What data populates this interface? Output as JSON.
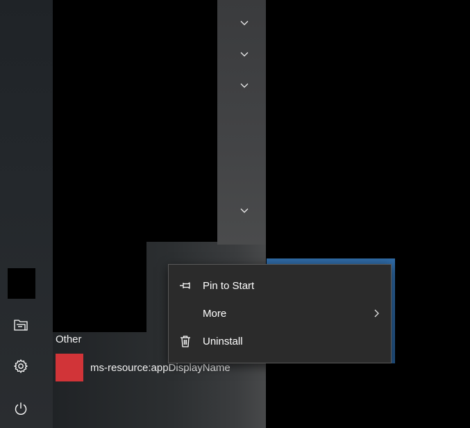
{
  "list": {
    "group_header": "Other",
    "apps": [
      {
        "label": "ms-resource:appDisplayName",
        "tile_color": "#d13438"
      }
    ]
  },
  "context_menu": {
    "items": [
      {
        "label": "Pin to Start",
        "icon": "pin-icon"
      },
      {
        "label": "More",
        "icon": "none",
        "submenu": true
      },
      {
        "label": "Uninstall",
        "icon": "trash-icon"
      }
    ]
  },
  "rail": {
    "items": [
      {
        "icon": "documents-icon"
      },
      {
        "icon": "gear-icon"
      },
      {
        "icon": "power-icon"
      }
    ]
  },
  "colors": {
    "accent_tile": "#d13438",
    "live_tile": "#2f6aa5",
    "menu_bg": "#2b2b2b"
  }
}
